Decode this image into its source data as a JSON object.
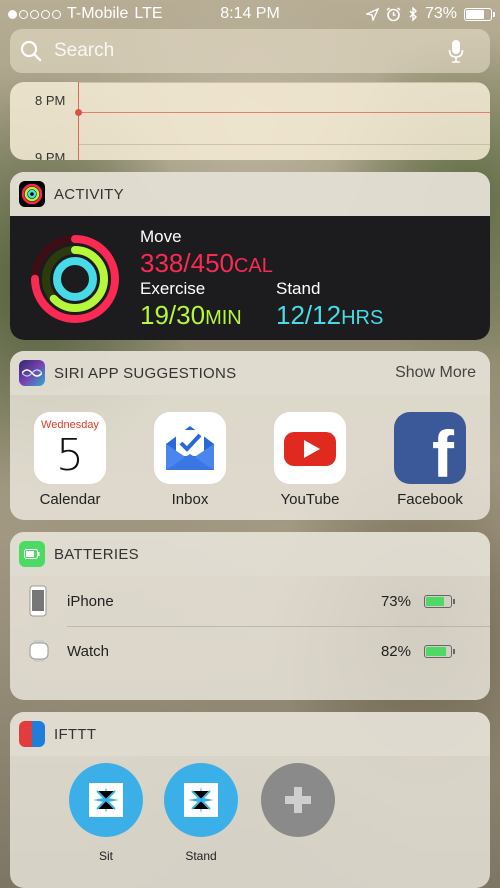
{
  "status_bar": {
    "carrier": "T-Mobile",
    "network": "LTE",
    "time": "8:14 PM",
    "battery_percent": "73%",
    "battery_level": 0.73,
    "signal_bars": 1,
    "icons": [
      "location-arrow-icon",
      "alarm-icon",
      "bluetooth-icon",
      "battery-icon"
    ]
  },
  "search": {
    "placeholder": "Search"
  },
  "calendar": {
    "times": [
      "8 PM",
      "9 PM"
    ]
  },
  "activity": {
    "title": "ACTIVITY",
    "move": {
      "label": "Move",
      "value": "338/450",
      "unit": "CAL",
      "fraction": 0.75
    },
    "exercise": {
      "label": "Exercise",
      "value": "19/30",
      "unit": "MIN",
      "fraction": 0.63
    },
    "stand": {
      "label": "Stand",
      "value": "12/12",
      "unit": "HRS",
      "fraction": 1.0
    },
    "colors": {
      "move": "#fa2a55",
      "exercise": "#b5f73b",
      "stand": "#47dbe8"
    }
  },
  "siri": {
    "title": "SIRI APP SUGGESTIONS",
    "action": "Show More",
    "apps": [
      {
        "label": "Calendar",
        "day": "Wednesday",
        "date": "5"
      },
      {
        "label": "Inbox"
      },
      {
        "label": "YouTube"
      },
      {
        "label": "Facebook",
        "glyph": "f"
      }
    ]
  },
  "batteries": {
    "title": "BATTERIES",
    "devices": [
      {
        "name": "iPhone",
        "percent": "73%",
        "level": 0.73
      },
      {
        "name": "Watch",
        "percent": "82%",
        "level": 0.82
      }
    ]
  },
  "ifttt": {
    "title": "IFTTT",
    "recipes": [
      {
        "label": "Sit"
      },
      {
        "label": "Stand"
      },
      {
        "label": ""
      }
    ]
  }
}
